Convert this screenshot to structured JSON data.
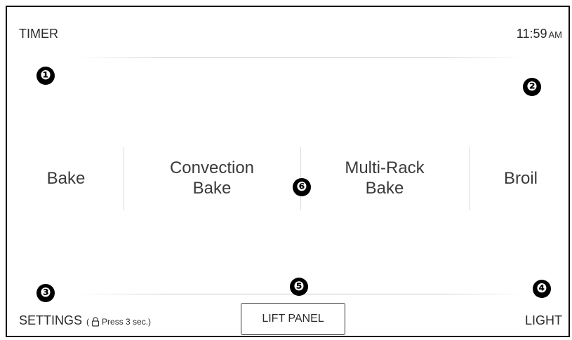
{
  "header": {
    "timer_label": "TIMER",
    "time": "11:59",
    "ampm": "AM"
  },
  "modes": [
    {
      "label_lines": [
        "Bake"
      ]
    },
    {
      "label_lines": [
        "Convection",
        "Bake"
      ]
    },
    {
      "label_lines": [
        "Multi-Rack",
        "Bake"
      ]
    },
    {
      "label_lines": [
        "Broil"
      ]
    }
  ],
  "callouts": [
    "❶",
    "❷",
    "❸",
    "❹",
    "❺",
    "❻"
  ],
  "footer": {
    "settings_label": "SETTINGS",
    "settings_hint_open": "(",
    "settings_hint_text": "Press 3 sec.)",
    "settings_hint_icon": "lock-icon",
    "lift_panel_label": "LIFT PANEL",
    "light_label": "LIGHT"
  },
  "colors": {
    "border": "#111111",
    "text": "#2a2a2a",
    "callout_bg": "#000000"
  }
}
